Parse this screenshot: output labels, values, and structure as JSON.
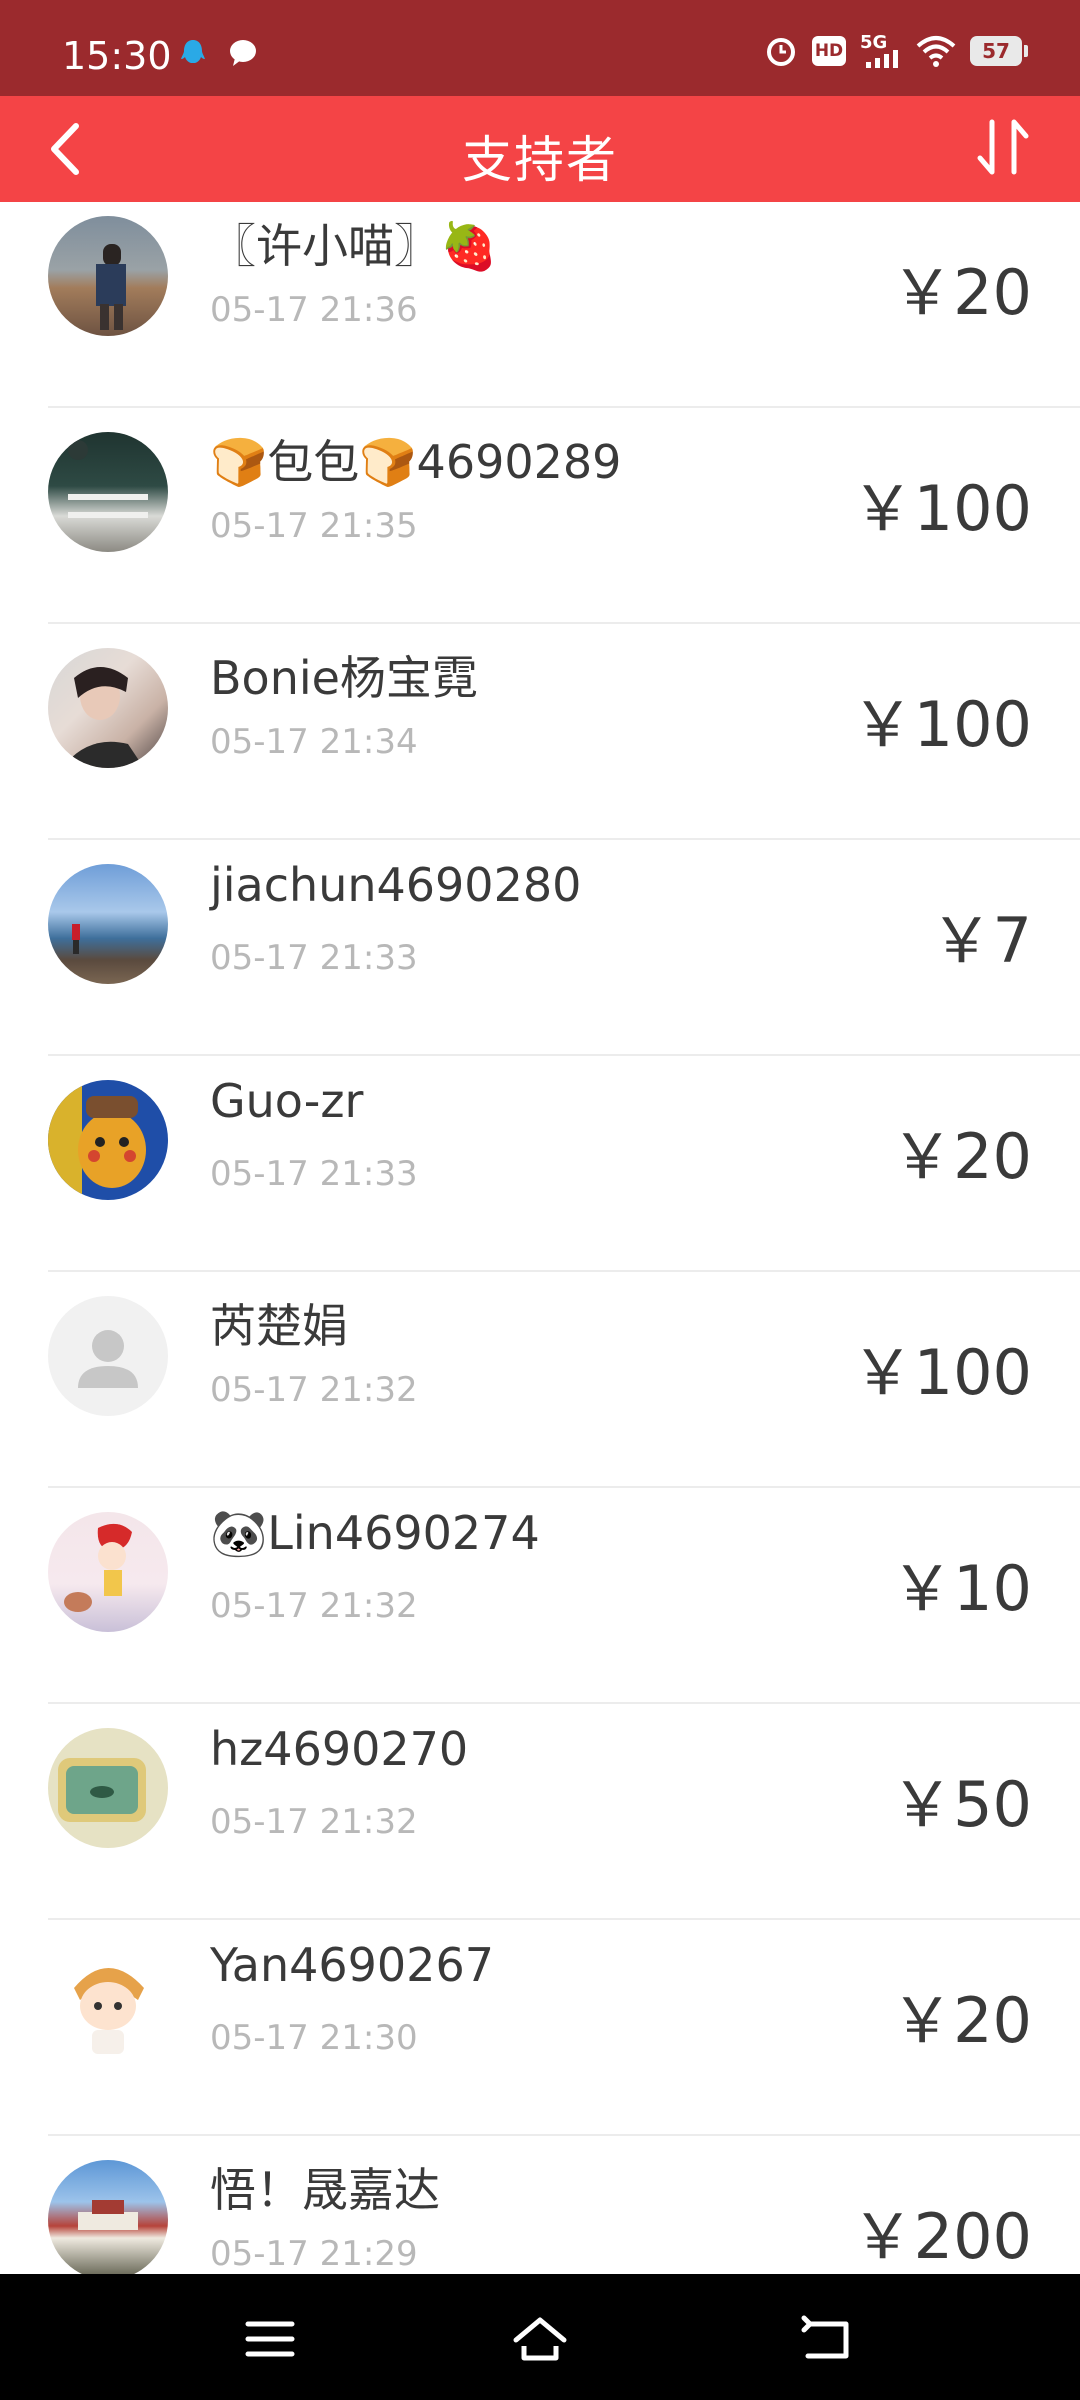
{
  "status_bar": {
    "time": "15:30",
    "network": "5G",
    "hd": "HD",
    "battery": "57"
  },
  "header": {
    "title": "支持者"
  },
  "supporters": [
    {
      "name": "〖许小喵〗🍓",
      "time": "05-17 21:36",
      "amount": "￥20"
    },
    {
      "name": "🍞包包🍞4690289",
      "time": "05-17 21:35",
      "amount": "￥100"
    },
    {
      "name": "Bonie杨宝霓",
      "time": "05-17 21:34",
      "amount": "￥100"
    },
    {
      "name": "jiachun4690280",
      "time": "05-17 21:33",
      "amount": "￥7"
    },
    {
      "name": "Guo-zr",
      "time": "05-17 21:33",
      "amount": "￥20"
    },
    {
      "name": "芮楚娟",
      "time": "05-17 21:32",
      "amount": "￥100"
    },
    {
      "name": "🐼Lin4690274",
      "time": "05-17 21:32",
      "amount": "￥10"
    },
    {
      "name": "hz4690270",
      "time": "05-17 21:32",
      "amount": "￥50"
    },
    {
      "name": "Yan4690267",
      "time": "05-17 21:30",
      "amount": "￥20"
    },
    {
      "name": "悟！晟嘉达",
      "time": "05-17 21:29",
      "amount": "￥200"
    }
  ],
  "colors": {
    "status_bar": "#9b2a2d",
    "header": "#f44446",
    "name": "#3a3a3a",
    "time": "#b8b8b8"
  },
  "icons": [
    "alarm-icon",
    "wifi-icon",
    "back-icon",
    "sort-icon",
    "menu-icon",
    "home-icon",
    "return-icon",
    "default-avatar-icon"
  ]
}
